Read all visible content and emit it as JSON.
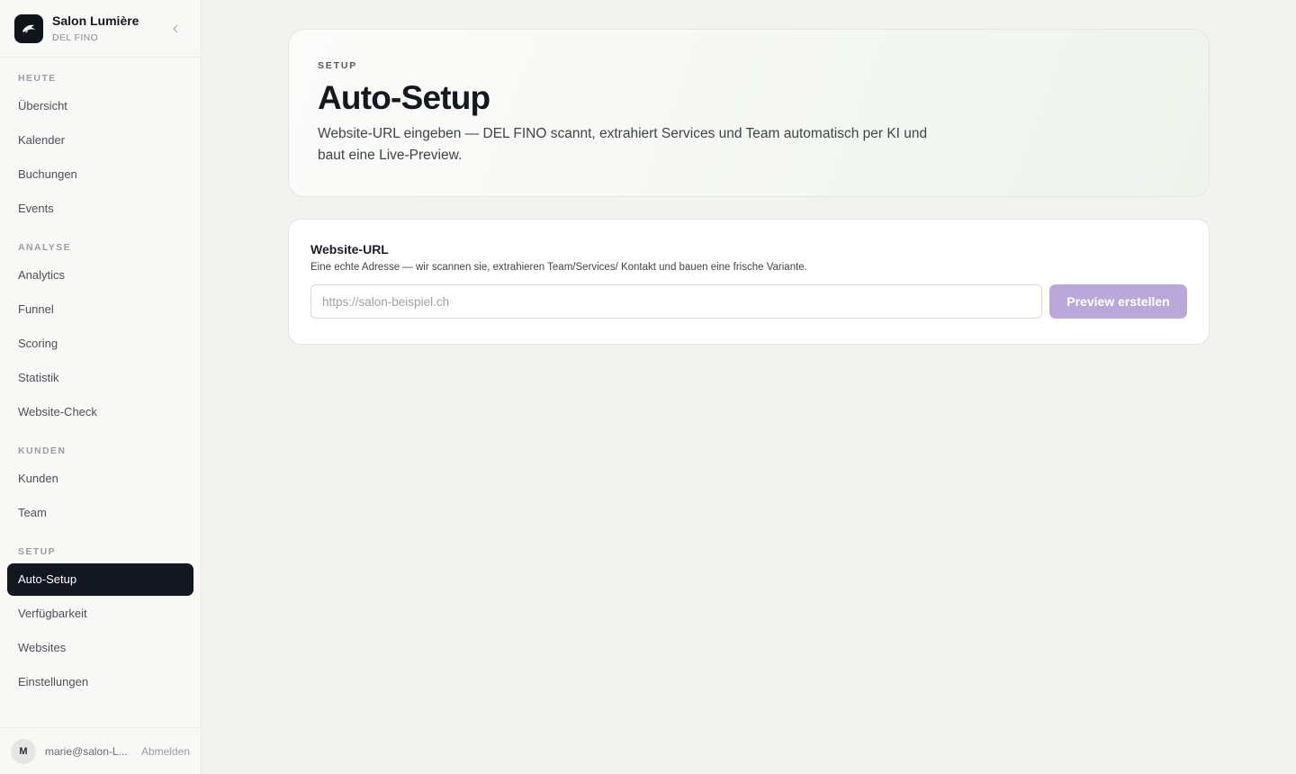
{
  "brand": {
    "name": "Salon Lumière",
    "subtitle": "DEL FINO"
  },
  "sidebar": {
    "sections": [
      {
        "heading": "HEUTE",
        "items": [
          "Übersicht",
          "Kalender",
          "Buchungen",
          "Events"
        ]
      },
      {
        "heading": "ANALYSE",
        "items": [
          "Analytics",
          "Funnel",
          "Scoring",
          "Statistik",
          "Website-Check"
        ]
      },
      {
        "heading": "KUNDEN",
        "items": [
          "Kunden",
          "Team"
        ]
      },
      {
        "heading": "SETUP",
        "items": [
          "Auto-Setup",
          "Verfügbarkeit",
          "Websites",
          "Einstellungen"
        ]
      }
    ],
    "active_item": "Auto-Setup"
  },
  "user": {
    "initial": "M",
    "email": "marie@salon-L...",
    "logout_label": "Abmelden"
  },
  "hero": {
    "eyebrow": "SETUP",
    "title": "Auto-Setup",
    "description": "Website-URL eingeben — DEL FINO scannt, extrahiert Services und Team automatisch per KI und baut eine Live-Preview."
  },
  "url_card": {
    "label": "Website-URL",
    "help": "Eine echte Adresse — wir scannen sie, extrahieren Team/Services/ Kontakt und bauen eine frische Variante.",
    "input_value": "",
    "input_placeholder": "https://salon-beispiel.ch",
    "button_label": "Preview erstellen"
  },
  "colors": {
    "active_nav_bg": "#121722",
    "button_bg": "#b9a8d8",
    "logo_bg": "#11141b"
  }
}
